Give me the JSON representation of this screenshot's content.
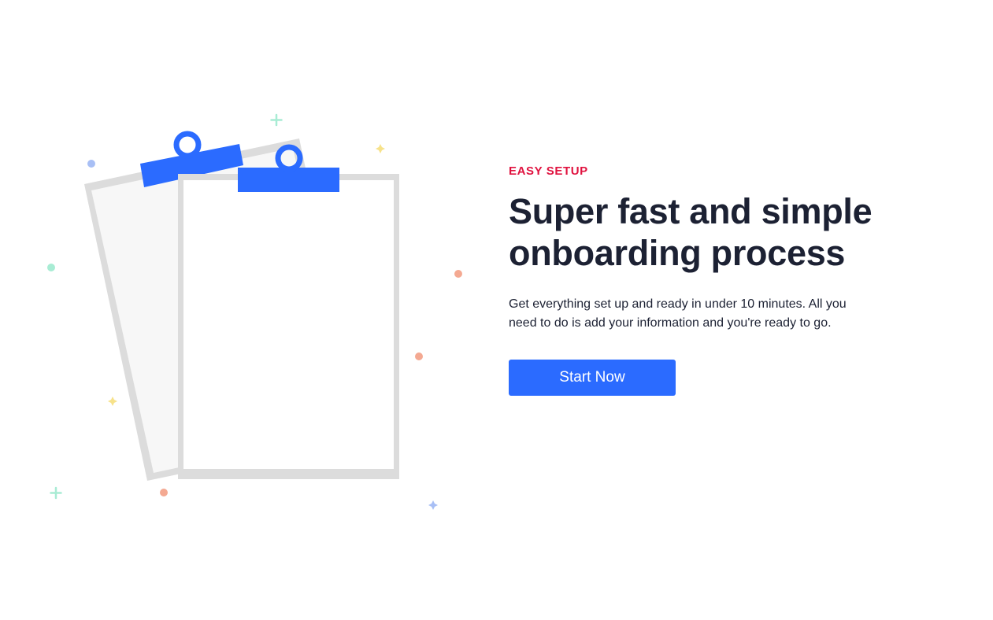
{
  "hero": {
    "eyebrow": "EASY SETUP",
    "headline": "Super fast and simple onboarding process",
    "description": "Get everything set up and ready in under 10 minutes. All you need to do is add your information and you're ready to go.",
    "cta_label": "Start Now"
  },
  "illustration": {
    "icon": "clipboards-illustration",
    "colors": {
      "clip": "#2b6bff",
      "paper_border": "#dcdcdc",
      "paper_back_fill": "#f7f7f7",
      "paper_front_fill": "#ffffff",
      "confetti_green": "#a8ecd4",
      "confetti_salmon": "#f4a992",
      "confetti_blue": "#a8bff5",
      "confetti_yellow": "#f7e28a"
    }
  },
  "theme": {
    "accent": "#2b6bff",
    "eyebrow_color": "#e0123f",
    "text_color": "#1c2133"
  }
}
